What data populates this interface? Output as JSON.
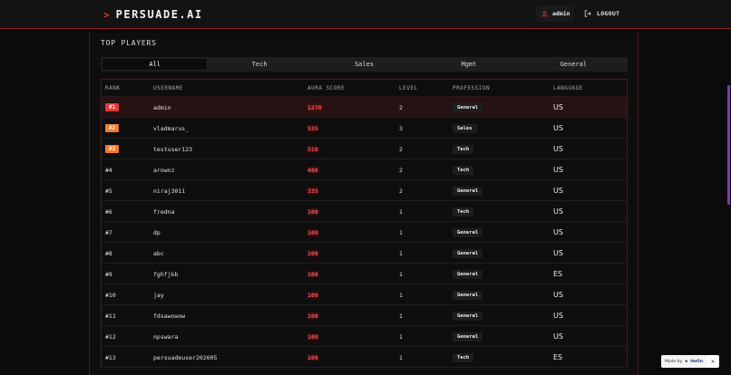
{
  "header": {
    "brand": "PERSUADE.AI",
    "brand_icon": "chevron-right-icon",
    "user_label": "admin",
    "logout_label": "LOGOUT",
    "accent_color": "#e53935"
  },
  "leaderboard": {
    "title": "TOP PLAYERS",
    "tabs": [
      {
        "label": "All",
        "active": true
      },
      {
        "label": "Tech",
        "active": false
      },
      {
        "label": "Sales",
        "active": false
      },
      {
        "label": "Mgmt",
        "active": false
      },
      {
        "label": "General",
        "active": false
      }
    ],
    "columns": {
      "rank": "RANK",
      "username": "USERNAME",
      "aura": "AURA SCORE",
      "level": "LEVEL",
      "profession": "PROFESSION",
      "language": "LANGUAGE"
    },
    "rows": [
      {
        "rank": "#1",
        "badge_color": "#e53935",
        "username": "admin",
        "aura": "1270",
        "level": "2",
        "profession": "General",
        "language": "US"
      },
      {
        "rank": "#2",
        "badge_color": "#f27b2c",
        "username": "vladmarus_",
        "aura": "535",
        "level": "3",
        "profession": "Sales",
        "language": "US"
      },
      {
        "rank": "#3",
        "badge_color": "#f27b2c",
        "username": "testuser123",
        "aura": "510",
        "level": "2",
        "profession": "Tech",
        "language": "US"
      },
      {
        "rank": "#4",
        "username": "arownz",
        "aura": "480",
        "level": "2",
        "profession": "Tech",
        "language": "US"
      },
      {
        "rank": "#5",
        "username": "niraj3011",
        "aura": "335",
        "level": "2",
        "profession": "General",
        "language": "US"
      },
      {
        "rank": "#6",
        "username": "fredna",
        "aura": "100",
        "level": "1",
        "profession": "Tech",
        "language": "US"
      },
      {
        "rank": "#7",
        "username": "dp",
        "aura": "100",
        "level": "1",
        "profession": "General",
        "language": "US"
      },
      {
        "rank": "#8",
        "username": "abc",
        "aura": "100",
        "level": "1",
        "profession": "General",
        "language": "US"
      },
      {
        "rank": "#9",
        "username": "fghfjkb",
        "aura": "100",
        "level": "1",
        "profession": "General",
        "language": "ES"
      },
      {
        "rank": "#10",
        "username": "jay",
        "aura": "100",
        "level": "1",
        "profession": "General",
        "language": "US"
      },
      {
        "rank": "#11",
        "username": "fdsawowow",
        "aura": "100",
        "level": "1",
        "profession": "General",
        "language": "US"
      },
      {
        "rank": "#12",
        "username": "npswara",
        "aura": "100",
        "level": "1",
        "profession": "General",
        "language": "US"
      },
      {
        "rank": "#13",
        "username": "persuadeuser202605",
        "aura": "100",
        "level": "1",
        "profession": "Tech",
        "language": "ES"
      }
    ]
  },
  "made_by": {
    "label": "Made by",
    "brand": "HeOn",
    "close": "×"
  }
}
